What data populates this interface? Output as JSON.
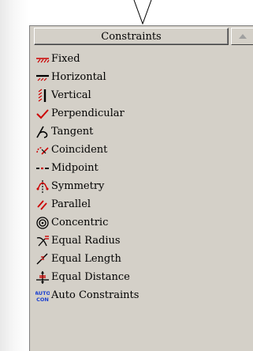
{
  "panel": {
    "title": "Constraints"
  },
  "items": [
    {
      "label": "Fixed",
      "icon": "fixed-icon"
    },
    {
      "label": "Horizontal",
      "icon": "horizontal-icon"
    },
    {
      "label": "Vertical",
      "icon": "vertical-icon"
    },
    {
      "label": "Perpendicular",
      "icon": "perpendicular-icon"
    },
    {
      "label": "Tangent",
      "icon": "tangent-icon"
    },
    {
      "label": "Coincident",
      "icon": "coincident-icon"
    },
    {
      "label": "Midpoint",
      "icon": "midpoint-icon"
    },
    {
      "label": "Symmetry",
      "icon": "symmetry-icon"
    },
    {
      "label": "Parallel",
      "icon": "parallel-icon"
    },
    {
      "label": "Concentric",
      "icon": "concentric-icon"
    },
    {
      "label": "Equal Radius",
      "icon": "equal-radius-icon"
    },
    {
      "label": "Equal Length",
      "icon": "equal-length-icon"
    },
    {
      "label": "Equal Distance",
      "icon": "equal-distance-icon"
    },
    {
      "label": "Auto Constraints",
      "icon": "auto-constraints-icon",
      "icon_text_top": "AUTO",
      "icon_text_bottom": "CON"
    }
  ],
  "colors": {
    "panel_bg": "#d4d0c8",
    "icon_red": "#cc0000",
    "icon_blue": "#1a3fd0"
  }
}
